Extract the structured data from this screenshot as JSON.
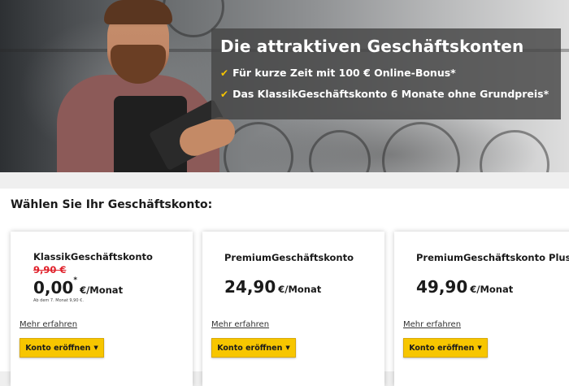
{
  "hero": {
    "title": "Die attraktiven Geschäftskonten",
    "bullets": [
      "Für kurze Zeit mit 100 € Online-Bonus*",
      "Das KlassikGeschäftskonto 6 Monate ohne Grundpreis*"
    ],
    "check_icon": "checkmark-icon",
    "accent_color": "#f5c400"
  },
  "section": {
    "heading": "Wählen Sie Ihr Geschäftskonto:"
  },
  "cards": [
    {
      "name": "KlassikGeschäftskonto",
      "old_price": "9,90 €",
      "price": "0,00",
      "asterisk": "*",
      "unit": "€/Monat",
      "note": "Ab dem 7. Monat 9,90 €.",
      "more_link": "Mehr erfahren",
      "button_label": "Konto eröffnen"
    },
    {
      "name": "PremiumGeschäftskonto",
      "price": "24,90",
      "unit": "€/Monat",
      "more_link": "Mehr erfahren",
      "button_label": "Konto eröffnen"
    },
    {
      "name": "PremiumGeschäftskonto Plus",
      "price": "49,90",
      "unit": "€/Monat",
      "more_link": "Mehr erfahren",
      "button_label": "Konto eröffnen"
    }
  ],
  "colors": {
    "button": "#f7c600",
    "strike_price": "#e0202a"
  }
}
